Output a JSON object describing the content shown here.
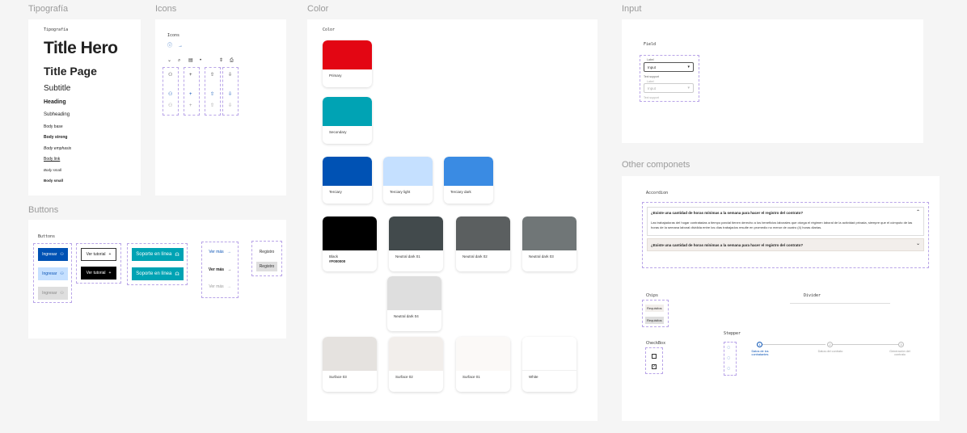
{
  "sections": {
    "typography": "Tipografía",
    "icons": "Icons",
    "color": "Color",
    "input": "Input",
    "buttons": "Buttons",
    "other": "Other componets"
  },
  "typography": {
    "frame_label": "Tipografía",
    "title_hero": "Title Hero",
    "title_page": "Title Page",
    "subtitle": "Subtitle",
    "heading": "Heading",
    "subheading": "Subheading",
    "body_base": "Body base",
    "body_strong": "Body strong",
    "body_emphasis": "Body emphasis",
    "body_link": "Body link",
    "body_small": "Body small",
    "body_small_strong": "Body small"
  },
  "icons": {
    "frame_label": "Icons"
  },
  "color": {
    "frame_label": "Color",
    "swatches": [
      {
        "name": "Primary",
        "color": "#e30613"
      },
      {
        "name": "Secondary",
        "color": "#00a3b4"
      },
      {
        "name": "Terciary",
        "color": "#0052b4"
      },
      {
        "name": "Terciary light",
        "color": "#c5e0ff"
      },
      {
        "name": "Terciary dark",
        "color": "#3a8be3"
      },
      {
        "name": "Black",
        "hex": "#F000000",
        "color": "#000000"
      },
      {
        "name": "Neutral dark 01",
        "color": "#424a4c"
      },
      {
        "name": "Neutral dark 02",
        "color": "#5b5f60"
      },
      {
        "name": "Neutral dark 03",
        "color": "#707677"
      },
      {
        "name": "Neutral dark 04",
        "color": "#dedede"
      },
      {
        "name": "Surface 03",
        "color": "#e5e2df"
      },
      {
        "name": "Surface 02",
        "color": "#f2eeeb"
      },
      {
        "name": "Surface 01",
        "color": "#fbf9f7"
      },
      {
        "name": "White",
        "color": "#ffffff"
      }
    ]
  },
  "input": {
    "frame_label": "Field",
    "label1": "Label",
    "value1": "Input",
    "support1": "Text support",
    "label2": "Label",
    "value2": "Input",
    "support2": "Text support"
  },
  "buttons": {
    "frame_label": "Buttons",
    "ingresar": "Ingresar",
    "ver_tutorial": "Ver tutorial",
    "soporte": "Soporte en línea",
    "ver_mas": "Ver más",
    "registro": "Registro",
    "registro_btn": "Registro"
  },
  "other": {
    "accordion_label": "Accordion",
    "acc_q1": "¿Existe una cantidad de horas mínimas a la semana para hacer el registro del contrato?",
    "acc_a1": "Las trabajadoras del hogar contratadas a tiempo parcial tienen derecho a los beneficios laborales que otorga el régimen laboral de la actividad privada, siempre que el cómputo de las horas de la semana laboral dividida entre los días trabajados resulte en promedio no menor de cuatro (4) horas diarias.",
    "acc_q2": "¿Existe una cantidad de horas mínimas a la semana para hacer el registro del contrato?",
    "chips_label": "Chips",
    "chip1": "Requisitos",
    "chip2": "Requisitos",
    "divider_label": "Divider",
    "checkbox_label": "CheckBox",
    "stepper_label": "Stepper",
    "step1_num": "1",
    "step1": "Datos de los contratantes",
    "step2_num": "2",
    "step2": "Datos del contrato",
    "step3_num": "3",
    "step3": "Generación del contrato"
  },
  "colors": {
    "accent": "#0b54b5",
    "dashed": "#b9a5e8",
    "teal": "#00a3b4"
  }
}
